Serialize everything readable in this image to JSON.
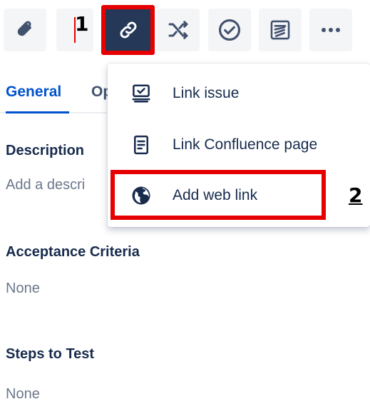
{
  "annotations": {
    "step_1": "1",
    "step_2": "2",
    "highlight_color": "#e60000"
  },
  "toolbar": {
    "items": [
      {
        "icon": "paperclip-icon",
        "tooltip": ""
      },
      {
        "icon": "child-issue-icon",
        "tooltip": ""
      },
      {
        "icon": "link-icon",
        "tooltip": "",
        "active": true
      },
      {
        "icon": "shuffle-icon",
        "tooltip": ""
      },
      {
        "icon": "check-circle-icon",
        "tooltip": ""
      },
      {
        "icon": "template-icon",
        "tooltip": ""
      },
      {
        "icon": "more-icon",
        "tooltip": ""
      }
    ],
    "active_bg": "#253858"
  },
  "tabs": {
    "general": "General",
    "other": "Op",
    "active_color": "#0052cc"
  },
  "fields": {
    "description": {
      "label": "Description",
      "value": "Add a descri"
    },
    "acceptance_criteria": {
      "label": "Acceptance Criteria",
      "value": "None"
    },
    "steps_to_test": {
      "label": "Steps to Test",
      "value": "None"
    }
  },
  "link_menu": {
    "items": [
      {
        "label": "Link issue",
        "icon": "link-issue-icon"
      },
      {
        "label": "Link Confluence page",
        "icon": "confluence-page-icon"
      },
      {
        "label": "Add web link",
        "icon": "globe-icon"
      }
    ]
  }
}
